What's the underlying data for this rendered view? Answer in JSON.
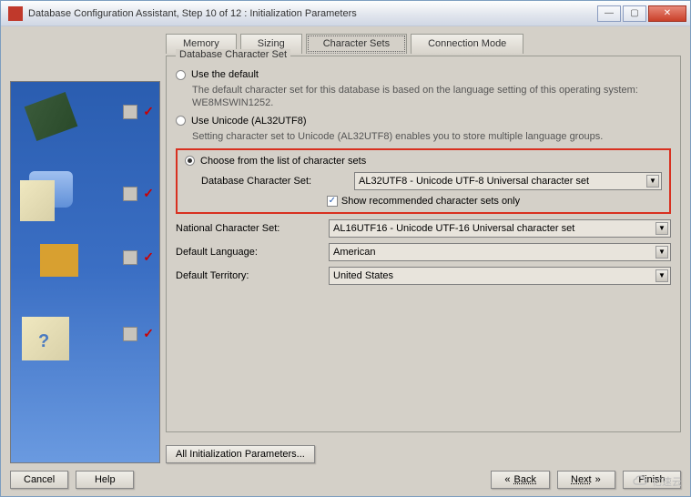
{
  "window": {
    "title": "Database Configuration Assistant, Step 10 of 12 : Initialization Parameters"
  },
  "tabs": {
    "memory": "Memory",
    "sizing": "Sizing",
    "char_sets": "Character Sets",
    "conn_mode": "Connection Mode"
  },
  "fieldset_title": "Database Character Set",
  "options": {
    "default": {
      "label": "Use the default",
      "desc": "The default character set for this database is based on the language setting of this operating system: WE8MSWIN1252."
    },
    "unicode": {
      "label": "Use Unicode (AL32UTF8)",
      "desc": "Setting character set to Unicode (AL32UTF8) enables you to store multiple language groups."
    },
    "list": {
      "label": "Choose from the list of character sets",
      "db_charset_label": "Database Character Set:",
      "db_charset_value": "AL32UTF8 - Unicode UTF-8 Universal character set",
      "show_recommended": "Show recommended character sets only"
    }
  },
  "national": {
    "label": "National Character Set:",
    "value": "AL16UTF16 - Unicode UTF-16 Universal character set"
  },
  "default_lang": {
    "label": "Default Language:",
    "value": "American"
  },
  "default_terr": {
    "label": "Default Territory:",
    "value": "United States"
  },
  "all_params": "All Initialization Parameters...",
  "footer": {
    "cancel": "Cancel",
    "help": "Help",
    "back": "Back",
    "next": "Next",
    "finish": "Finish"
  },
  "watermark": "亿速云"
}
